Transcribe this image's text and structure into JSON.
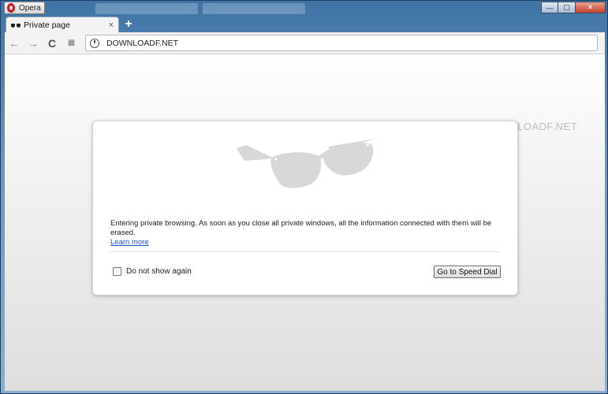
{
  "window": {
    "app_name": "Opera",
    "controls": {
      "minimize": "—",
      "maximize": "▢",
      "close": "✕"
    }
  },
  "tabs": [
    {
      "title": "Private page",
      "icon": "private-glasses-icon",
      "close": "×"
    }
  ],
  "new_tab_label": "+",
  "toolbar": {
    "back": "←",
    "forward": "→",
    "reload": "C",
    "speed_dial": "▦",
    "address": "DOWNLOADF.NET",
    "address_icon": "clock-icon"
  },
  "watermark": "DOWNLOADF.NET",
  "dialog": {
    "message": "Entering private browsing. As soon as you close all private windows, all the information connected with them will be erased.",
    "learn_more": "Learn more",
    "dont_show_again": "Do not show again",
    "dont_show_checked": false,
    "button": "Go to Speed Dial"
  },
  "colors": {
    "frame_blue": "#3f74a6",
    "opera_red": "#d6121f",
    "link": "#1a57c7",
    "glasses_grey": "#d8d8d8"
  }
}
